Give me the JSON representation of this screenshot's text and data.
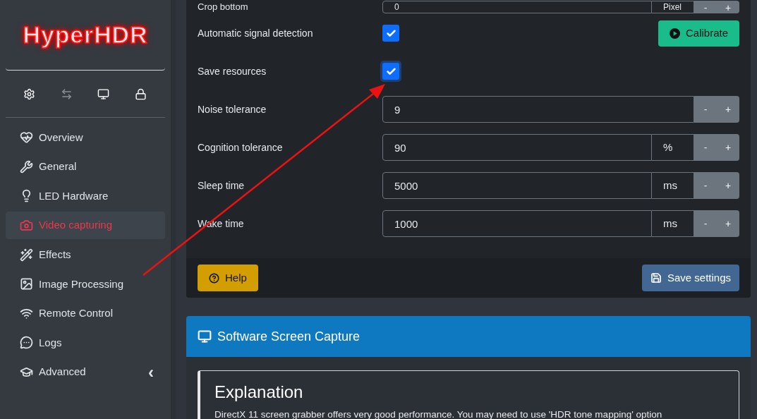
{
  "sidebar": {
    "logo": "HyperHDR",
    "toolbar": [
      {
        "disabled": false
      },
      {
        "disabled": true
      },
      {
        "disabled": false
      },
      {
        "disabled": false
      }
    ],
    "items": [
      {
        "label": "Overview",
        "selected": false
      },
      {
        "label": "General",
        "selected": false
      },
      {
        "label": "LED Hardware",
        "selected": false
      },
      {
        "label": "Video capturing",
        "selected": true
      },
      {
        "label": "Effects",
        "selected": false
      },
      {
        "label": "Image Processing",
        "selected": false
      },
      {
        "label": "Remote Control",
        "selected": false
      },
      {
        "label": "Logs",
        "selected": false
      },
      {
        "label": "Advanced",
        "selected": false,
        "expandable": "‹"
      }
    ]
  },
  "settings": {
    "rows": [
      {
        "kind": "number",
        "label": "Crop bottom",
        "value": "0",
        "unit": "Pixel",
        "minus": "-",
        "plus": "+"
      },
      {
        "kind": "checkbox",
        "label": "Automatic signal detection",
        "checked": true,
        "focused": false,
        "action": "Calibrate"
      },
      {
        "kind": "checkbox",
        "label": "Save resources",
        "checked": true,
        "focused": true
      },
      {
        "kind": "number",
        "label": "Noise tolerance",
        "value": "9",
        "minus": "-",
        "plus": "+"
      },
      {
        "kind": "number",
        "label": "Cognition tolerance",
        "value": "90",
        "unit": "%",
        "minus": "-",
        "plus": "+"
      },
      {
        "kind": "number",
        "label": "Sleep time",
        "value": "5000",
        "unit": "ms",
        "minus": "-",
        "plus": "+"
      },
      {
        "kind": "number",
        "label": "Wake time",
        "value": "1000",
        "unit": "ms",
        "minus": "-",
        "plus": "+"
      }
    ],
    "help_button": "Help",
    "save_button": "Save settings"
  },
  "panel": {
    "title": "Software Screen Capture",
    "explanation_title": "Explanation",
    "explanation": "DirectX 11 screen grabber offers very good performance. You may need to use 'HDR tone mapping' option"
  }
}
